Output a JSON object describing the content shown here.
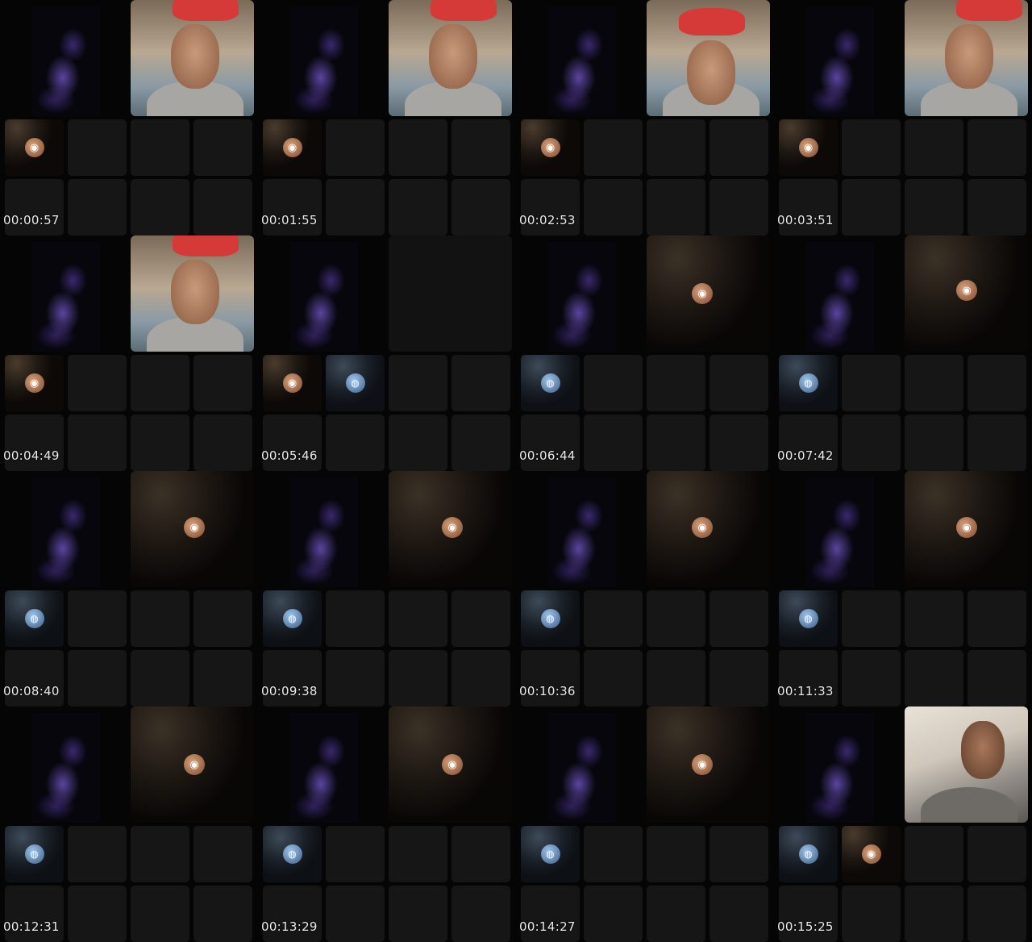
{
  "timestamps": [
    "00:00:57",
    "00:01:55",
    "00:02:53",
    "00:03:51",
    "00:04:49",
    "00:05:46",
    "00:06:44",
    "00:07:42",
    "00:08:40",
    "00:09:38",
    "00:10:36",
    "00:11:33",
    "00:12:31",
    "00:13:29",
    "00:14:27",
    "00:15:25"
  ],
  "icons": {
    "camera_avatar": "camera-icon",
    "globe_avatar": "globe-icon"
  },
  "colors": {
    "background": "#000000",
    "tile": "#161616",
    "cap_red": "#d63a38",
    "smoke_purple": "#7a5ad2"
  }
}
